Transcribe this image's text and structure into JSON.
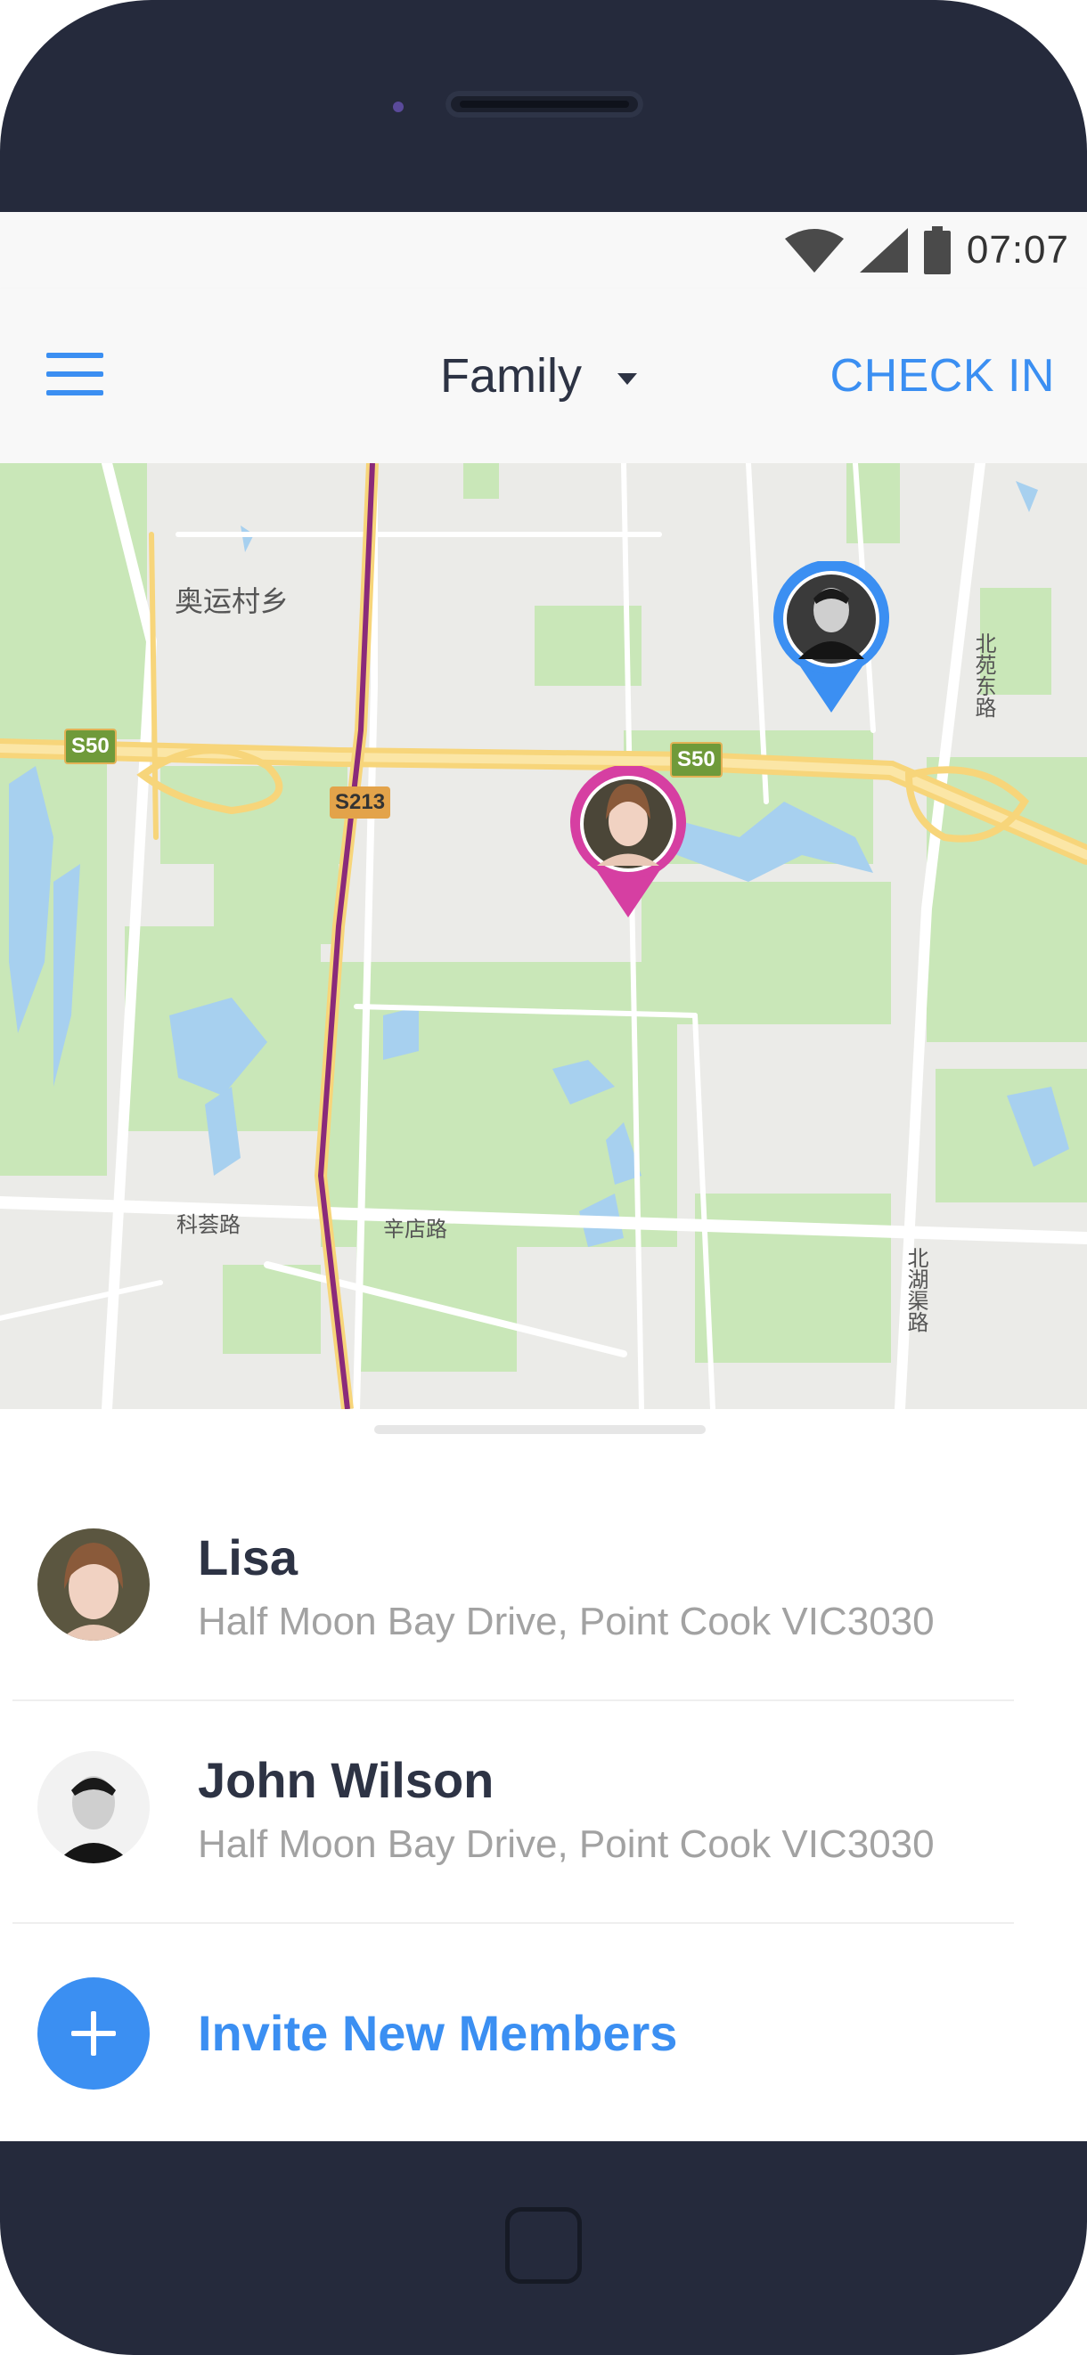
{
  "status_bar": {
    "time": "07:07",
    "icons": [
      "wifi-icon",
      "signal-icon",
      "battery-icon"
    ]
  },
  "app_bar": {
    "menu_icon": "hamburger-menu-icon",
    "group_label": "Family",
    "check_in_label": "CHECK IN"
  },
  "map": {
    "place_labels": [
      "奥运村乡",
      "科荟路",
      "辛店路",
      "北苑东路",
      "北湖渠路"
    ],
    "road_shields": [
      "S50",
      "S213",
      "S50"
    ],
    "refresh_icon": "refresh-icon"
  },
  "members": [
    {
      "name": "Lisa",
      "address": "Half Moon Bay Drive, Point Cook VIC3030",
      "pin_color": "#d63fa2"
    },
    {
      "name": "John Wilson",
      "address": "Half Moon Bay Drive, Point Cook VIC3030",
      "pin_color": "#3b8ff2"
    }
  ],
  "invite": {
    "label": "Invite New Members",
    "icon": "plus-icon"
  },
  "colors": {
    "accent": "#3b8ff2",
    "bezel": "#252a3c",
    "map_green": "#c9e7b8",
    "map_base": "#ebebe8"
  }
}
